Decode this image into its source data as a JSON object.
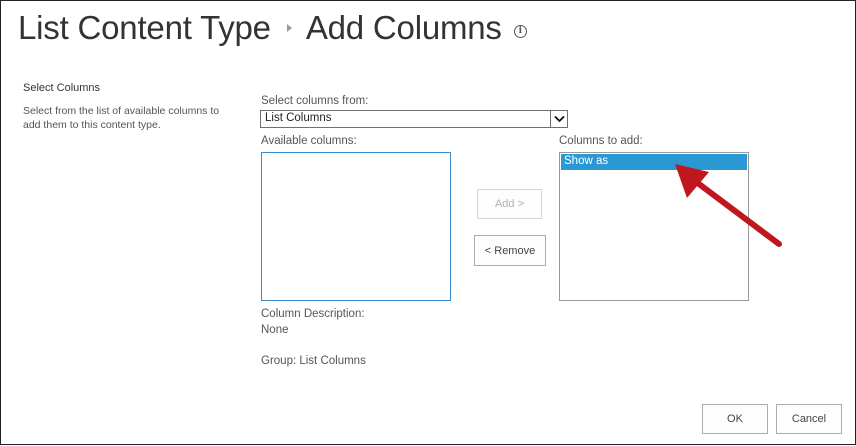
{
  "header": {
    "breadcrumb_parent": "List Content Type",
    "page_title": "Add Columns",
    "info_glyph": "i"
  },
  "section": {
    "title": "Select Columns",
    "description": "Select from the list of available columns to add them to this content type."
  },
  "selector": {
    "label": "Select columns from:",
    "value": "List Columns"
  },
  "available": {
    "label": "Available columns:",
    "items": []
  },
  "to_add": {
    "label": "Columns to add:",
    "items": [
      "Show as"
    ],
    "selected_index": 0
  },
  "buttons": {
    "add": "Add >",
    "remove": "< Remove",
    "ok": "OK",
    "cancel": "Cancel"
  },
  "details": {
    "description_label": "Column Description:",
    "description_value": "None",
    "group": "Group: List Columns"
  },
  "colors": {
    "selection": "#2a98d5",
    "annotation_arrow": "#c0161d",
    "focus_border": "#3b8dd3"
  },
  "icons": {
    "info": "info-icon",
    "breadcrumb_separator": "breadcrumb-arrow-icon",
    "dropdown": "chevron-down-icon",
    "annotation": "arrow-annotation-icon"
  }
}
